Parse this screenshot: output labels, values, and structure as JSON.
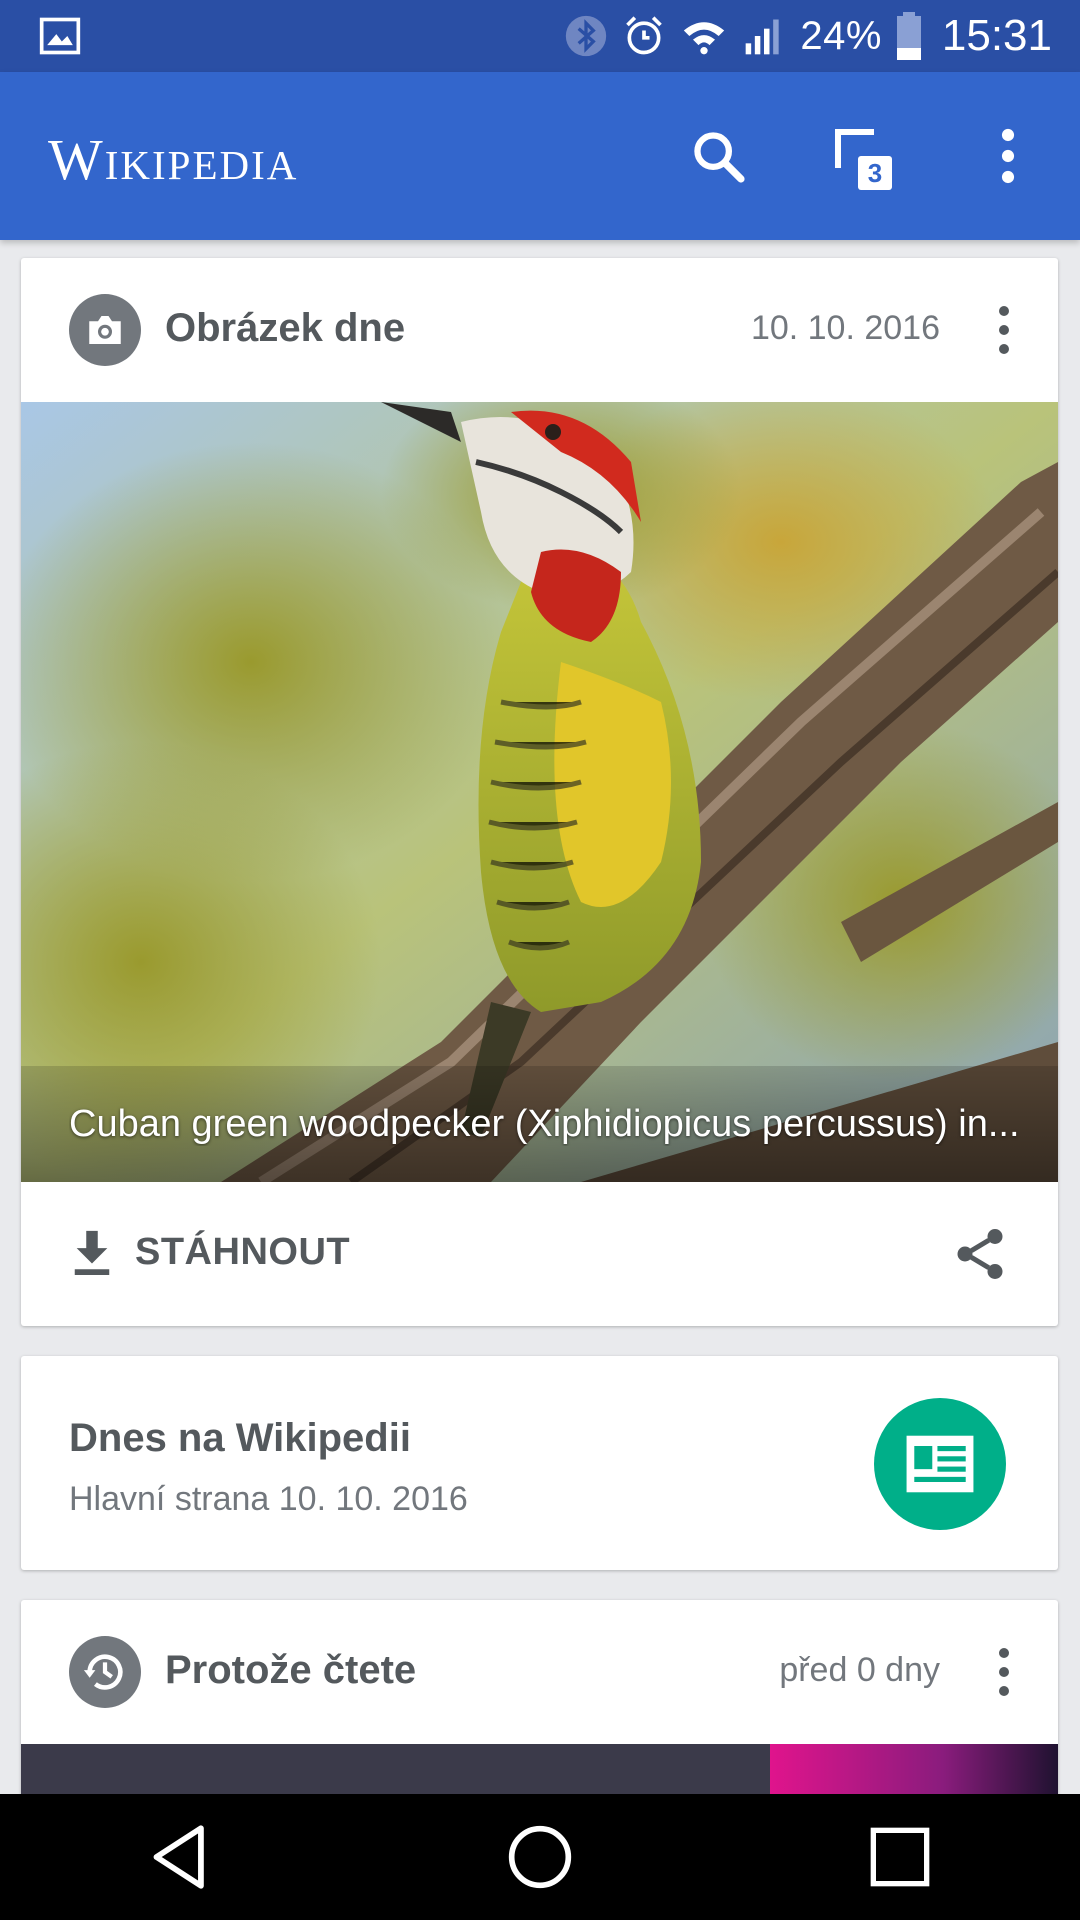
{
  "status_bar": {
    "battery": "24%",
    "time": "15:31",
    "icons": [
      "gallery-icon",
      "bluetooth-icon",
      "alarm-icon",
      "wifi-icon",
      "signal-icon",
      "battery-icon"
    ]
  },
  "app_bar": {
    "wordmark": "Wikipedia",
    "tabs_count": "3",
    "icons": [
      "search-icon",
      "tabs-icon",
      "more-vert-icon"
    ]
  },
  "potd_card": {
    "title": "Obrázek dne",
    "date": "10. 10. 2016",
    "caption": "Cuban green woodpecker (Xiphidiopicus percussus) in...",
    "download_label": "STÁHNOUT",
    "icons": [
      "camera-icon",
      "download-icon",
      "share-icon",
      "more-vert-icon"
    ]
  },
  "featured_card": {
    "title": "Dnes na Wikipedii",
    "subtitle": "Hlavní strana 10. 10. 2016",
    "icons": [
      "newspaper-icon"
    ]
  },
  "because_card": {
    "title": "Protože čtete",
    "date": "před 0 dny",
    "icons": [
      "history-icon",
      "more-vert-icon"
    ]
  },
  "nav_bar": {
    "icons": [
      "back-icon",
      "home-icon",
      "recents-icon"
    ]
  },
  "colors": {
    "status_bar": "#2a4fa5",
    "app_bar": "#3366cc",
    "fab": "#00af89",
    "background": "#e9eaed"
  }
}
